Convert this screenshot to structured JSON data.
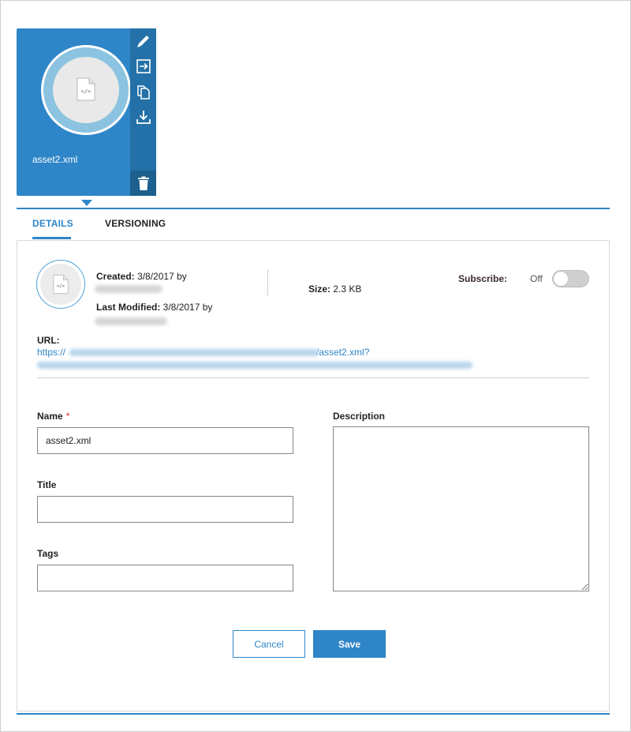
{
  "asset": {
    "name": "asset2.xml",
    "type_icon": "xml-file-icon",
    "actions": [
      "edit-icon",
      "move-icon",
      "copy-icon",
      "download-icon",
      "delete-icon"
    ]
  },
  "tabs": [
    {
      "label": "DETAILS",
      "active": true
    },
    {
      "label": "VERSIONING",
      "active": false
    }
  ],
  "meta": {
    "created_label": "Created:",
    "created_value": "3/8/2017 by",
    "modified_label": "Last Modified:",
    "modified_value": "3/8/2017 by",
    "size_label": "Size:",
    "size_value": "2.3 KB"
  },
  "subscribe": {
    "label": "Subscribe:",
    "state": "Off"
  },
  "url": {
    "label": "URL:",
    "prefix": "https://",
    "suffix": "/asset2.xml?"
  },
  "form": {
    "name_label": "Name",
    "required_mark": "*",
    "name_value": "asset2.xml",
    "title_label": "Title",
    "title_value": "",
    "tags_label": "Tags",
    "tags_value": "",
    "description_label": "Description",
    "description_value": ""
  },
  "buttons": {
    "cancel": "Cancel",
    "save": "Save"
  },
  "colors": {
    "accent": "#2e86c8",
    "tile_actions": "#2371a8"
  }
}
